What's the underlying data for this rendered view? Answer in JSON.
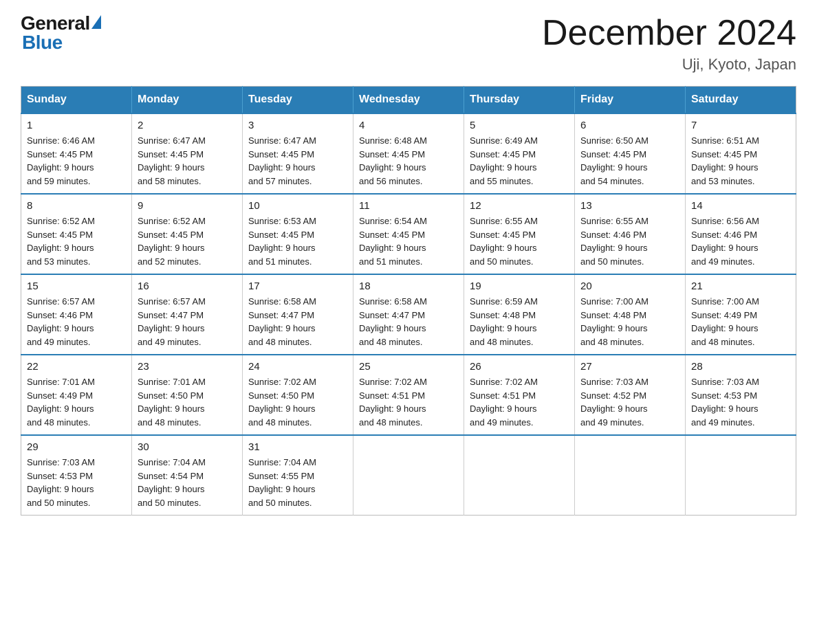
{
  "header": {
    "logo_general": "General",
    "logo_blue": "Blue",
    "month_title": "December 2024",
    "location": "Uji, Kyoto, Japan"
  },
  "weekdays": [
    "Sunday",
    "Monday",
    "Tuesday",
    "Wednesday",
    "Thursday",
    "Friday",
    "Saturday"
  ],
  "weeks": [
    [
      {
        "day": "1",
        "sunrise": "6:46 AM",
        "sunset": "4:45 PM",
        "daylight": "9 hours and 59 minutes."
      },
      {
        "day": "2",
        "sunrise": "6:47 AM",
        "sunset": "4:45 PM",
        "daylight": "9 hours and 58 minutes."
      },
      {
        "day": "3",
        "sunrise": "6:47 AM",
        "sunset": "4:45 PM",
        "daylight": "9 hours and 57 minutes."
      },
      {
        "day": "4",
        "sunrise": "6:48 AM",
        "sunset": "4:45 PM",
        "daylight": "9 hours and 56 minutes."
      },
      {
        "day": "5",
        "sunrise": "6:49 AM",
        "sunset": "4:45 PM",
        "daylight": "9 hours and 55 minutes."
      },
      {
        "day": "6",
        "sunrise": "6:50 AM",
        "sunset": "4:45 PM",
        "daylight": "9 hours and 54 minutes."
      },
      {
        "day": "7",
        "sunrise": "6:51 AM",
        "sunset": "4:45 PM",
        "daylight": "9 hours and 53 minutes."
      }
    ],
    [
      {
        "day": "8",
        "sunrise": "6:52 AM",
        "sunset": "4:45 PM",
        "daylight": "9 hours and 53 minutes."
      },
      {
        "day": "9",
        "sunrise": "6:52 AM",
        "sunset": "4:45 PM",
        "daylight": "9 hours and 52 minutes."
      },
      {
        "day": "10",
        "sunrise": "6:53 AM",
        "sunset": "4:45 PM",
        "daylight": "9 hours and 51 minutes."
      },
      {
        "day": "11",
        "sunrise": "6:54 AM",
        "sunset": "4:45 PM",
        "daylight": "9 hours and 51 minutes."
      },
      {
        "day": "12",
        "sunrise": "6:55 AM",
        "sunset": "4:45 PM",
        "daylight": "9 hours and 50 minutes."
      },
      {
        "day": "13",
        "sunrise": "6:55 AM",
        "sunset": "4:46 PM",
        "daylight": "9 hours and 50 minutes."
      },
      {
        "day": "14",
        "sunrise": "6:56 AM",
        "sunset": "4:46 PM",
        "daylight": "9 hours and 49 minutes."
      }
    ],
    [
      {
        "day": "15",
        "sunrise": "6:57 AM",
        "sunset": "4:46 PM",
        "daylight": "9 hours and 49 minutes."
      },
      {
        "day": "16",
        "sunrise": "6:57 AM",
        "sunset": "4:47 PM",
        "daylight": "9 hours and 49 minutes."
      },
      {
        "day": "17",
        "sunrise": "6:58 AM",
        "sunset": "4:47 PM",
        "daylight": "9 hours and 48 minutes."
      },
      {
        "day": "18",
        "sunrise": "6:58 AM",
        "sunset": "4:47 PM",
        "daylight": "9 hours and 48 minutes."
      },
      {
        "day": "19",
        "sunrise": "6:59 AM",
        "sunset": "4:48 PM",
        "daylight": "9 hours and 48 minutes."
      },
      {
        "day": "20",
        "sunrise": "7:00 AM",
        "sunset": "4:48 PM",
        "daylight": "9 hours and 48 minutes."
      },
      {
        "day": "21",
        "sunrise": "7:00 AM",
        "sunset": "4:49 PM",
        "daylight": "9 hours and 48 minutes."
      }
    ],
    [
      {
        "day": "22",
        "sunrise": "7:01 AM",
        "sunset": "4:49 PM",
        "daylight": "9 hours and 48 minutes."
      },
      {
        "day": "23",
        "sunrise": "7:01 AM",
        "sunset": "4:50 PM",
        "daylight": "9 hours and 48 minutes."
      },
      {
        "day": "24",
        "sunrise": "7:02 AM",
        "sunset": "4:50 PM",
        "daylight": "9 hours and 48 minutes."
      },
      {
        "day": "25",
        "sunrise": "7:02 AM",
        "sunset": "4:51 PM",
        "daylight": "9 hours and 48 minutes."
      },
      {
        "day": "26",
        "sunrise": "7:02 AM",
        "sunset": "4:51 PM",
        "daylight": "9 hours and 49 minutes."
      },
      {
        "day": "27",
        "sunrise": "7:03 AM",
        "sunset": "4:52 PM",
        "daylight": "9 hours and 49 minutes."
      },
      {
        "day": "28",
        "sunrise": "7:03 AM",
        "sunset": "4:53 PM",
        "daylight": "9 hours and 49 minutes."
      }
    ],
    [
      {
        "day": "29",
        "sunrise": "7:03 AM",
        "sunset": "4:53 PM",
        "daylight": "9 hours and 50 minutes."
      },
      {
        "day": "30",
        "sunrise": "7:04 AM",
        "sunset": "4:54 PM",
        "daylight": "9 hours and 50 minutes."
      },
      {
        "day": "31",
        "sunrise": "7:04 AM",
        "sunset": "4:55 PM",
        "daylight": "9 hours and 50 minutes."
      },
      null,
      null,
      null,
      null
    ]
  ],
  "labels": {
    "sunrise": "Sunrise:",
    "sunset": "Sunset:",
    "daylight": "Daylight:"
  }
}
